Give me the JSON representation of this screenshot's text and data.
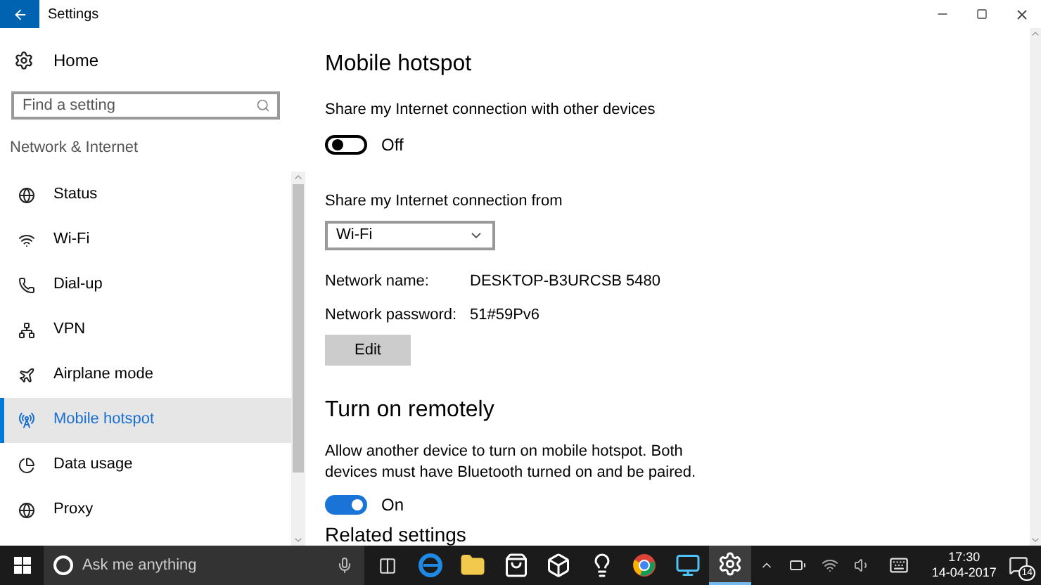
{
  "window": {
    "title": "Settings"
  },
  "sidebar": {
    "home": "Home",
    "search": {
      "placeholder": "Find a setting"
    },
    "section": "Network & Internet",
    "items": [
      {
        "label": "Status",
        "selected": false
      },
      {
        "label": "Wi-Fi",
        "selected": false
      },
      {
        "label": "Dial-up",
        "selected": false
      },
      {
        "label": "VPN",
        "selected": false
      },
      {
        "label": "Airplane mode",
        "selected": false
      },
      {
        "label": "Mobile hotspot",
        "selected": true
      },
      {
        "label": "Data usage",
        "selected": false
      },
      {
        "label": "Proxy",
        "selected": false
      }
    ]
  },
  "content": {
    "title": "Mobile hotspot",
    "share_label": "Share my Internet connection with other devices",
    "share_toggle": {
      "on": false,
      "label": "Off"
    },
    "from_label": "Share my Internet connection from",
    "from_select": {
      "value": "Wi-Fi"
    },
    "fields": [
      {
        "label": "Network name:",
        "value": "DESKTOP-B3URCSB 5480"
      },
      {
        "label": "Network password:",
        "value": "51#59Pv6"
      }
    ],
    "edit_button": "Edit",
    "remote_heading": "Turn on remotely",
    "remote_description": "Allow another device to turn on mobile hotspot. Both devices must have Bluetooth turned on and be paired.",
    "remote_toggle": {
      "on": true,
      "label": "On"
    },
    "related_heading": "Related settings"
  },
  "taskbar": {
    "search": {
      "placeholder": "Ask me anything"
    },
    "apps": [
      {
        "selected": false
      },
      {
        "selected": false
      },
      {
        "selected": false
      },
      {
        "selected": false
      },
      {
        "selected": false
      },
      {
        "selected": false
      },
      {
        "selected": false
      },
      {
        "selected": true
      }
    ],
    "time": "17:30",
    "date": "14-04-2017",
    "notification_count": "14"
  }
}
